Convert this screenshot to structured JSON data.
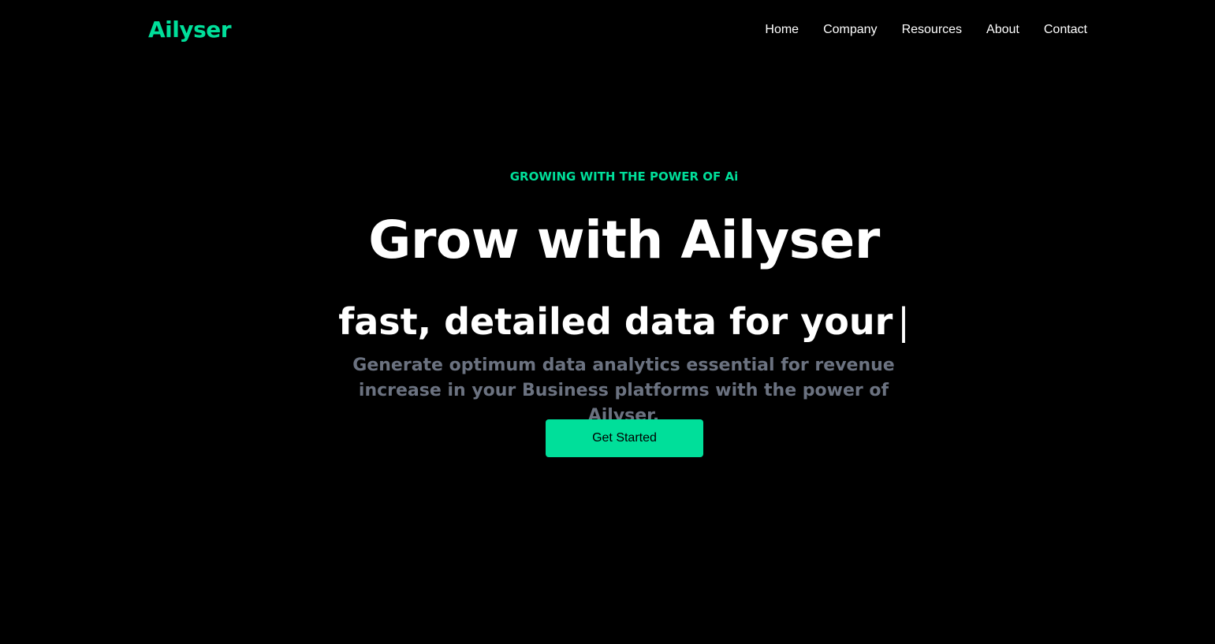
{
  "colors": {
    "background": "#000000",
    "accent": "#00df9a",
    "text_primary": "#ffffff",
    "text_muted": "#6b7280"
  },
  "navbar": {
    "logo": "Ailyser",
    "items": [
      {
        "label": "Home"
      },
      {
        "label": "Company"
      },
      {
        "label": "Resources"
      },
      {
        "label": "About"
      },
      {
        "label": "Contact"
      }
    ]
  },
  "hero": {
    "eyebrow": "GROWING WITH THE POWER OF Ai",
    "headline": "Grow with Ailyser",
    "typed_prefix": "fast, detailed data for your",
    "typed_cursor": "|",
    "subtext": "Generate optimum data analytics essential for revenue increase in your Business platforms with the power of Ailyser.",
    "cta_label": "Get Started"
  }
}
